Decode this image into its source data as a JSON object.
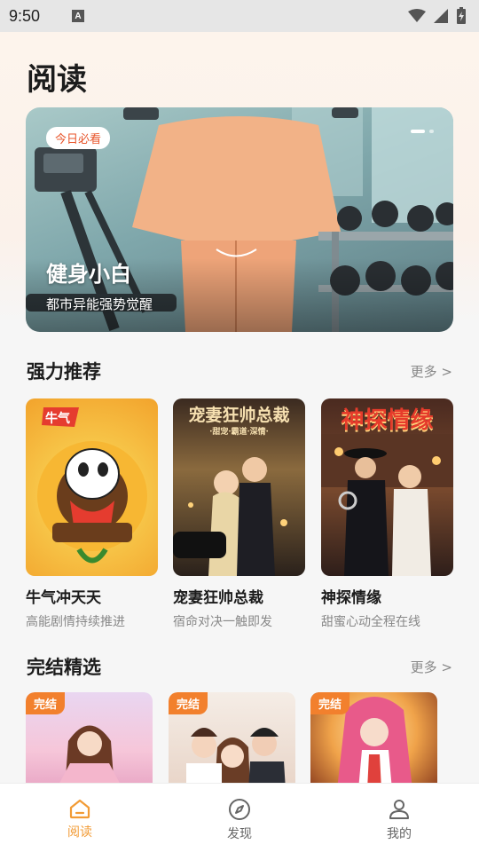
{
  "status_bar": {
    "time": "9:50",
    "indicator": "A"
  },
  "page": {
    "title": "阅读"
  },
  "banner": {
    "tag": "今日必看",
    "title": "健身小白",
    "subtitle": "都市异能强势觉醒"
  },
  "sections": {
    "recommend": {
      "title": "强力推荐",
      "more": "更多 >"
    },
    "finished": {
      "title": "完结精选",
      "more": "更多 >"
    }
  },
  "recommend_books": [
    {
      "title": "牛气冲天天",
      "subtitle": "高能剧情持续推进"
    },
    {
      "title": "宠妻狂帅总裁",
      "subtitle": "宿命对决一触即发",
      "cover_text": "宠妻狂帅总裁",
      "cover_sub": "·甜宠·霸道·深情·"
    },
    {
      "title": "神探情缘",
      "subtitle": "甜蜜心动全程在线",
      "cover_text": "神探情缘"
    }
  ],
  "finished_books": [
    {
      "badge": "完结"
    },
    {
      "badge": "完结"
    },
    {
      "badge": "完结"
    }
  ],
  "tabs": [
    {
      "label": "阅读",
      "icon": "home-icon",
      "active": true
    },
    {
      "label": "发现",
      "icon": "compass-icon",
      "active": false
    },
    {
      "label": "我的",
      "icon": "person-icon",
      "active": false
    }
  ],
  "colors": {
    "accent": "#f29b35",
    "badge": "#f2802d",
    "tag_text": "#e8552b"
  }
}
